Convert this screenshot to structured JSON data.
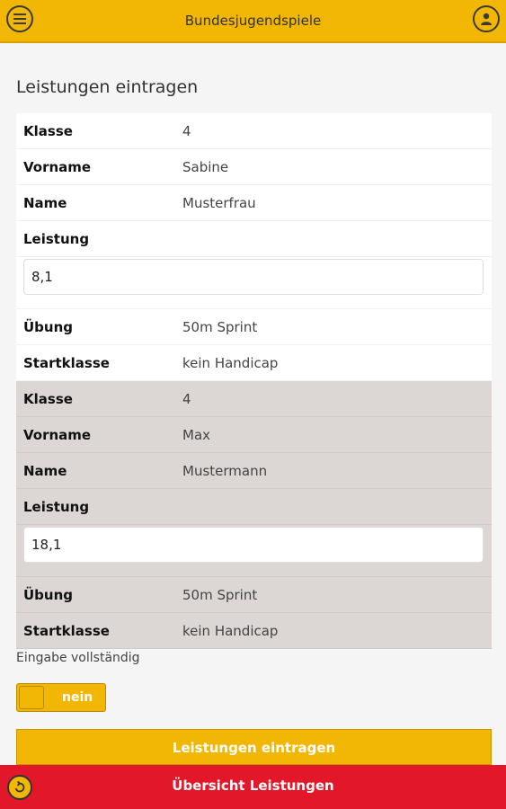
{
  "header": {
    "title": "Bundesjugendspiele",
    "menu_icon": "menu-icon",
    "user_icon": "user-icon"
  },
  "page": {
    "heading": "Leistungen eintragen"
  },
  "records": [
    {
      "klasse": {
        "label": "Klasse",
        "value": "4"
      },
      "vorname": {
        "label": "Vorname",
        "value": "Sabine"
      },
      "name": {
        "label": "Name",
        "value": "Musterfrau"
      },
      "leistung": {
        "label": "Leistung",
        "value": "8,1"
      },
      "uebung": {
        "label": "Übung",
        "value": "50m Sprint"
      },
      "startklasse": {
        "label": "Startklasse",
        "value": "kein Handicap"
      }
    },
    {
      "klasse": {
        "label": "Klasse",
        "value": "4"
      },
      "vorname": {
        "label": "Vorname",
        "value": "Max"
      },
      "name": {
        "label": "Name",
        "value": "Mustermann"
      },
      "leistung": {
        "label": "Leistung",
        "value": "18,1"
      },
      "uebung": {
        "label": "Übung",
        "value": "50m Sprint"
      },
      "startklasse": {
        "label": "Startklasse",
        "value": "kein Handicap"
      }
    }
  ],
  "completion": {
    "label": "Eingabe vollständig",
    "toggle_label": "nein"
  },
  "submit": {
    "label": "Leistungen eintragen"
  },
  "footer": {
    "title": "Übersicht Leistungen",
    "back_icon": "back-icon"
  },
  "colors": {
    "accent": "#f2b705",
    "footer": "#e2172a",
    "alt_row": "#dcd7d5"
  }
}
